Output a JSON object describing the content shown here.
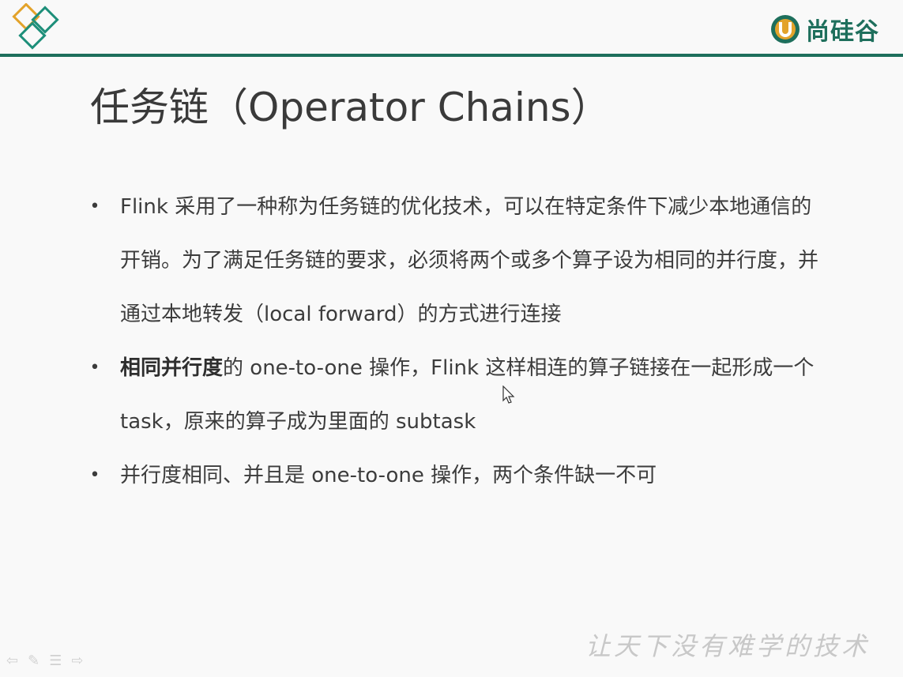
{
  "header": {
    "brand_name": "尚硅谷",
    "accent_color": "#1e6f5c",
    "corner_logo_colors": [
      "#e3a32b",
      "#1e8f7a"
    ]
  },
  "slide": {
    "title": "任务链（Operator Chains）",
    "bullets": [
      {
        "bold": "",
        "text": "Flink 采用了一种称为任务链的优化技术，可以在特定条件下减少本地通信的开销。为了满足任务链的要求，必须将两个或多个算子设为相同的并行度，并通过本地转发（local forward）的方式进行连接"
      },
      {
        "bold": "相同并行度",
        "text": "的 one-to-one 操作，Flink 这样相连的算子链接在一起形成一个 task，原来的算子成为里面的 subtask"
      },
      {
        "bold": "",
        "text": "并行度相同、并且是 one-to-one 操作，两个条件缺一不可"
      }
    ]
  },
  "footer": {
    "watermark": "让天下没有难学的技术",
    "nav_icons": [
      "arrow-left-icon",
      "pen-icon",
      "menu-icon",
      "arrow-right-icon"
    ]
  }
}
